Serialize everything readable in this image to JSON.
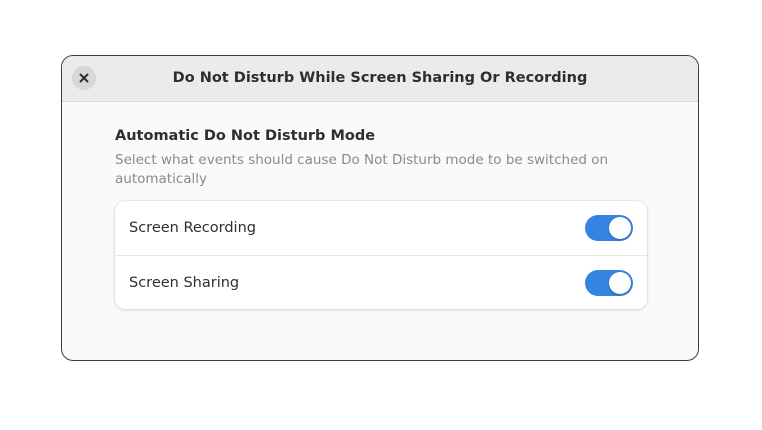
{
  "dialog": {
    "title": "Do Not Disturb While Screen Sharing Or Recording",
    "close_icon": "close-icon"
  },
  "group": {
    "title": "Automatic Do Not Disturb Mode",
    "description": "Select what events should cause Do Not Disturb mode to be switched on automatically"
  },
  "rows": [
    {
      "label": "Screen Recording",
      "enabled": true
    },
    {
      "label": "Screen Sharing",
      "enabled": true
    }
  ],
  "colors": {
    "accent": "#3584e4",
    "headerbar": "#ebebeb",
    "background": "#fafafa"
  }
}
